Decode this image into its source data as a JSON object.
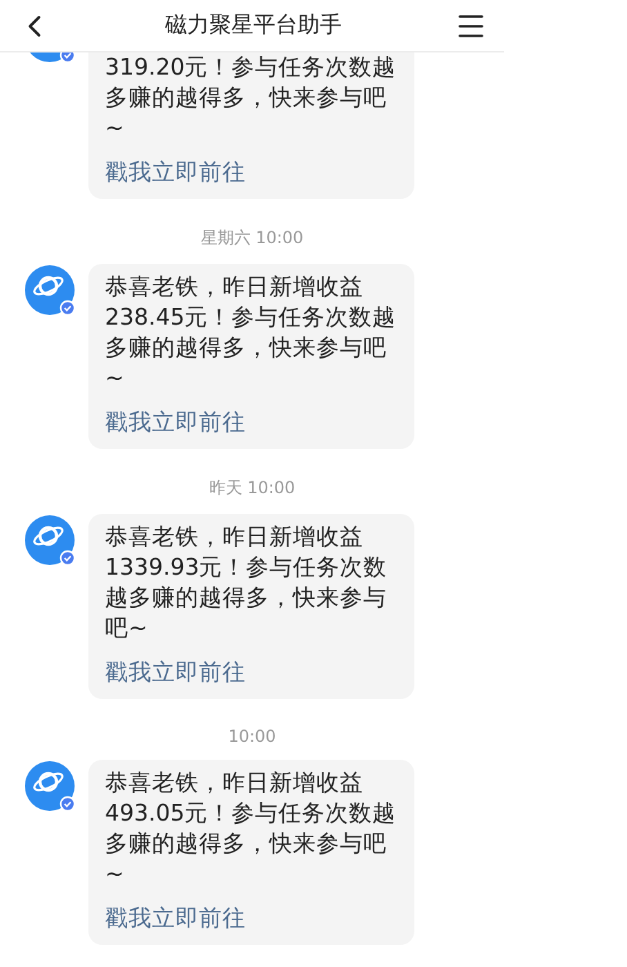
{
  "header": {
    "title": "磁力聚星平台助手"
  },
  "messages": [
    {
      "kind": "partial",
      "body": "319.20元！参与任务次数越多赚的越得多，快来参与吧~",
      "link": "戳我立即前往"
    },
    {
      "kind": "full",
      "time": "星期六 10:00",
      "body": "恭喜老铁，昨日新增收益238.45元！参与任务次数越多赚的越得多，快来参与吧~",
      "link": "戳我立即前往"
    },
    {
      "kind": "full",
      "time": "昨天 10:00",
      "body": "恭喜老铁，昨日新增收益1339.93元！参与任务次数越多赚的越得多，快来参与吧~",
      "link": "戳我立即前往"
    },
    {
      "kind": "full",
      "time": "10:00",
      "body": "恭喜老铁，昨日新增收益493.05元！参与任务次数越多赚的越得多，快来参与吧~",
      "link": "戳我立即前往"
    }
  ]
}
